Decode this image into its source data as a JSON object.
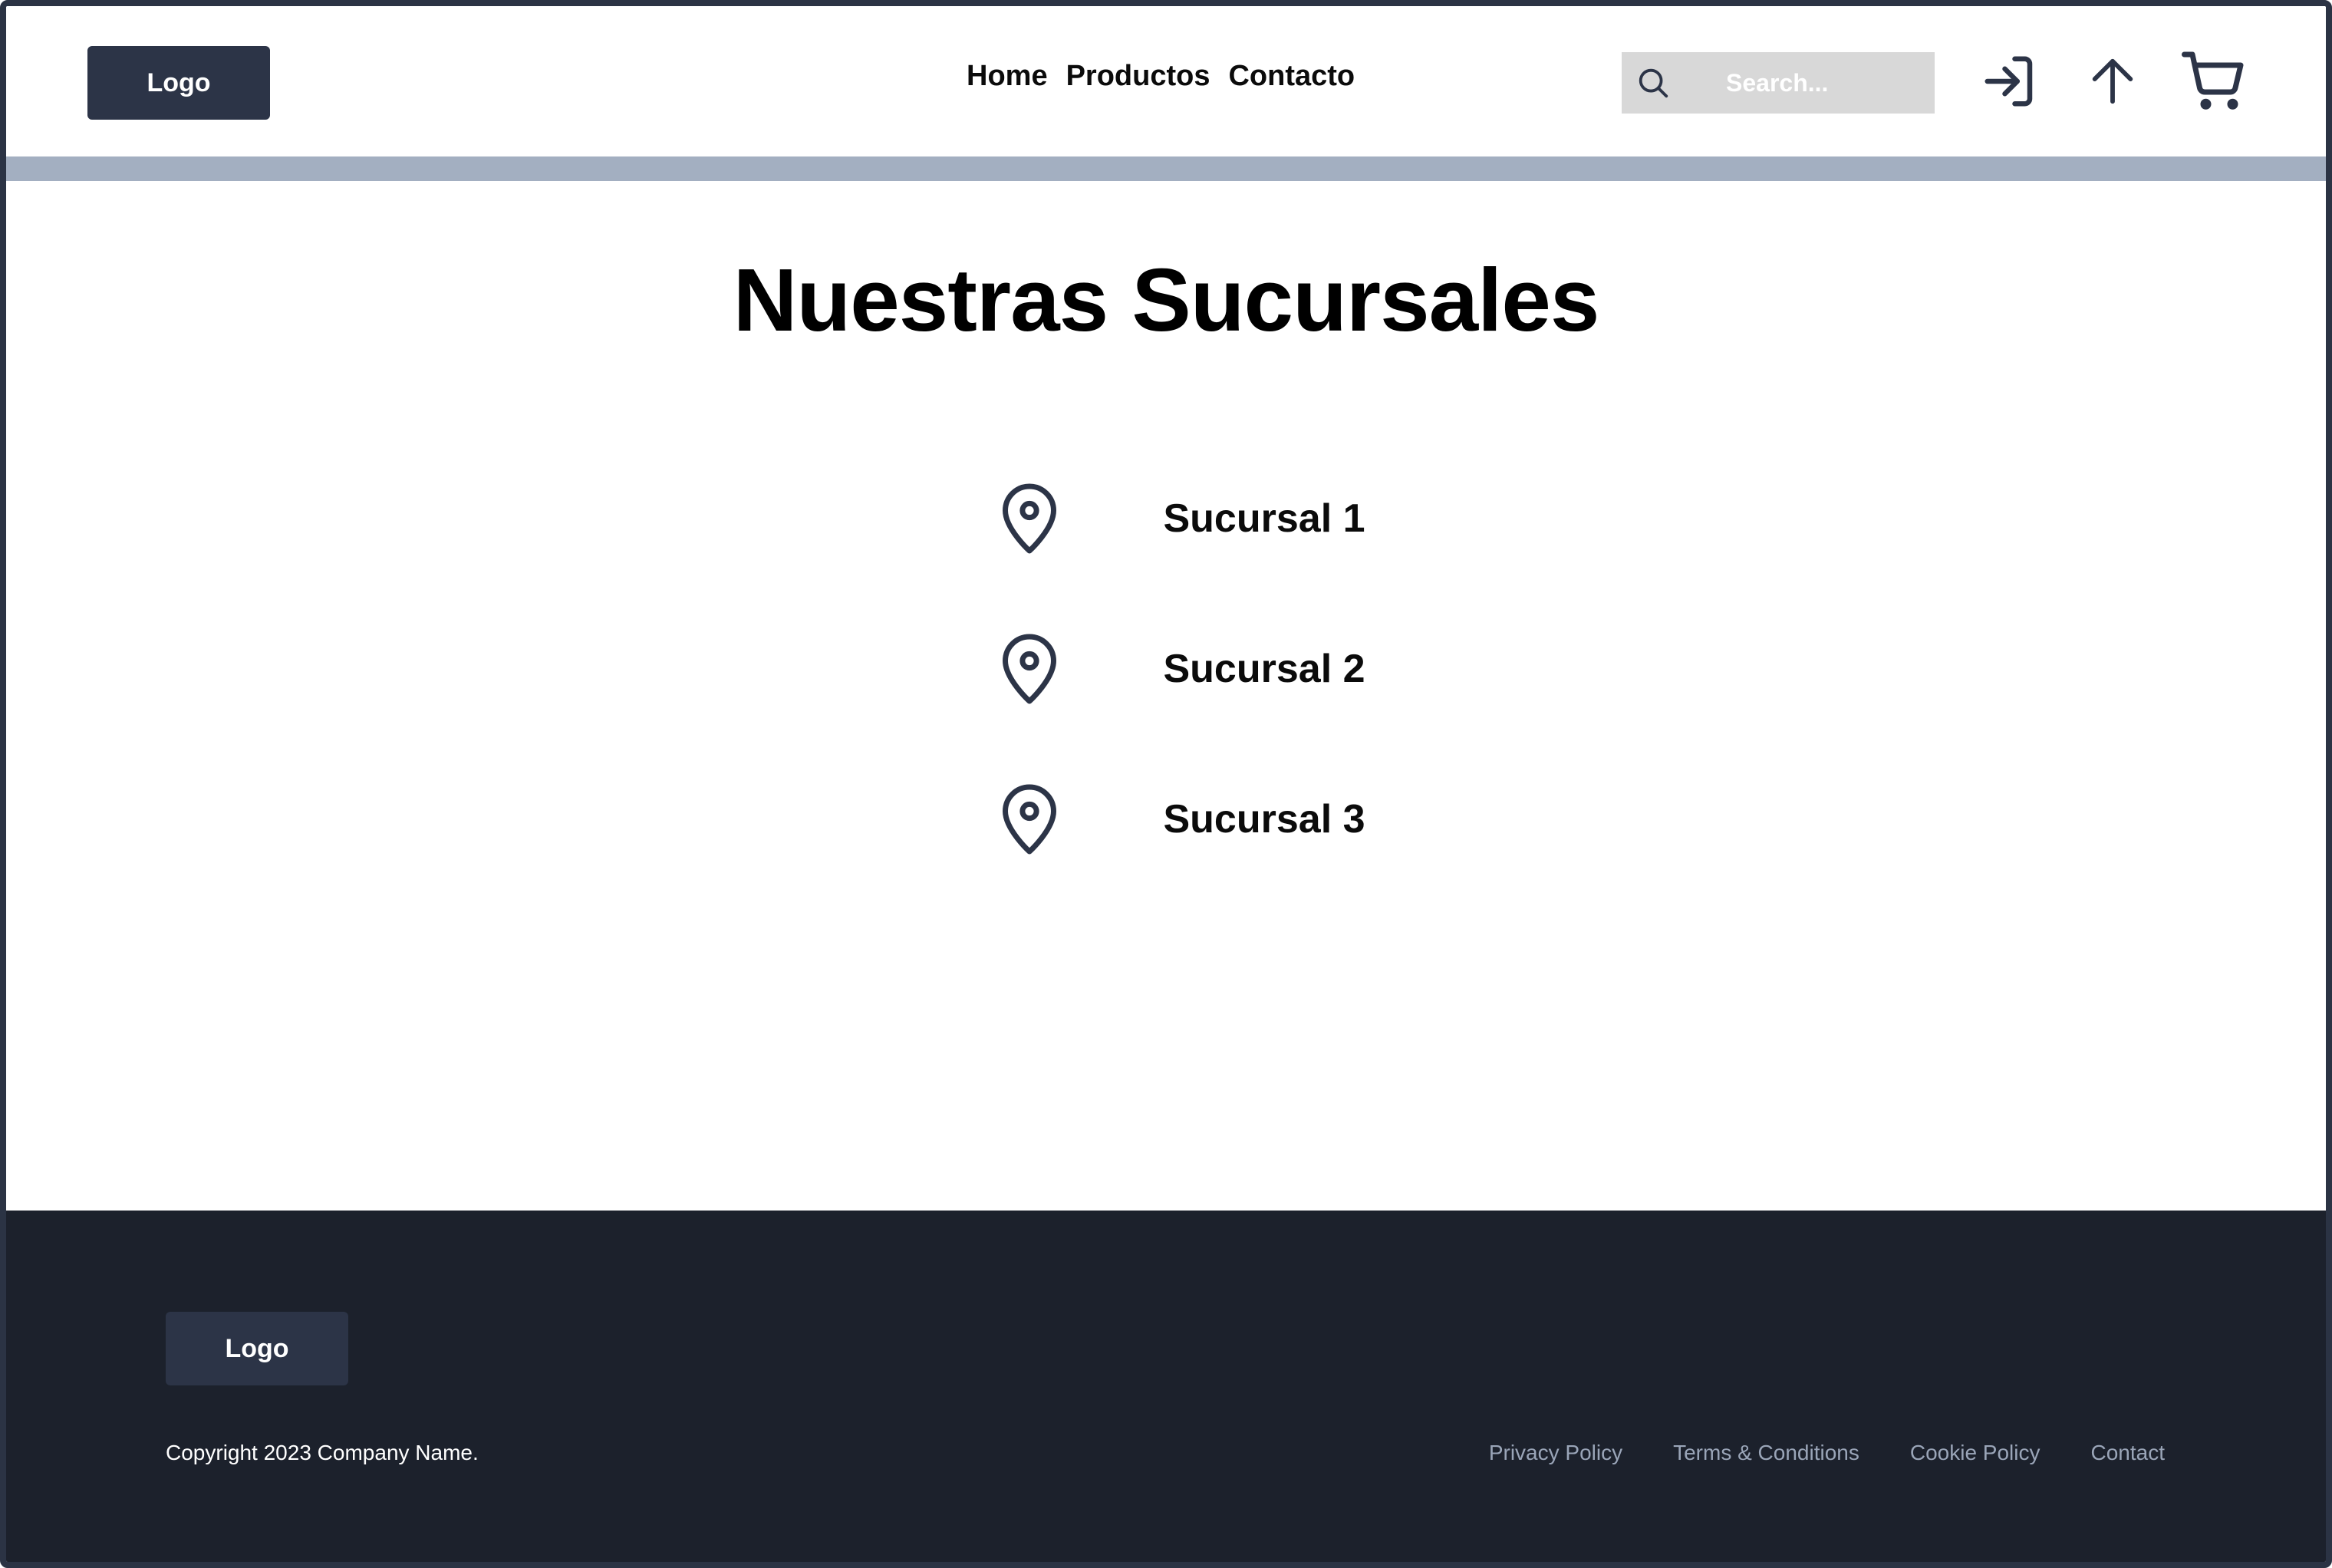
{
  "header": {
    "logo": "Logo",
    "nav": {
      "home": "Home",
      "productos": "Productos",
      "contacto": "Contacto"
    },
    "search": {
      "placeholder": "Search..."
    },
    "icons": {
      "search": "search-icon",
      "login": "login-icon",
      "upload": "arrow-up-icon",
      "cart": "cart-icon"
    }
  },
  "main": {
    "title": "Nuestras Sucursales",
    "branches": [
      {
        "label": "Sucursal 1",
        "icon": "map-pin-icon"
      },
      {
        "label": "Sucursal 2",
        "icon": "map-pin-icon"
      },
      {
        "label": "Sucursal 3",
        "icon": "map-pin-icon"
      }
    ]
  },
  "footer": {
    "logo": "Logo",
    "copyright": "Copyright 2023 Company Name.",
    "links": {
      "privacy": "Privacy Policy",
      "terms": "Terms & Conditions",
      "cookie": "Cookie Policy",
      "contact": "Contact"
    }
  },
  "colors": {
    "primary_dark": "#2c3447",
    "footer_bg": "#1c212c",
    "divider": "#a3afc1",
    "search_bg": "#d8d8d8",
    "footer_link": "#9aa5b8"
  }
}
